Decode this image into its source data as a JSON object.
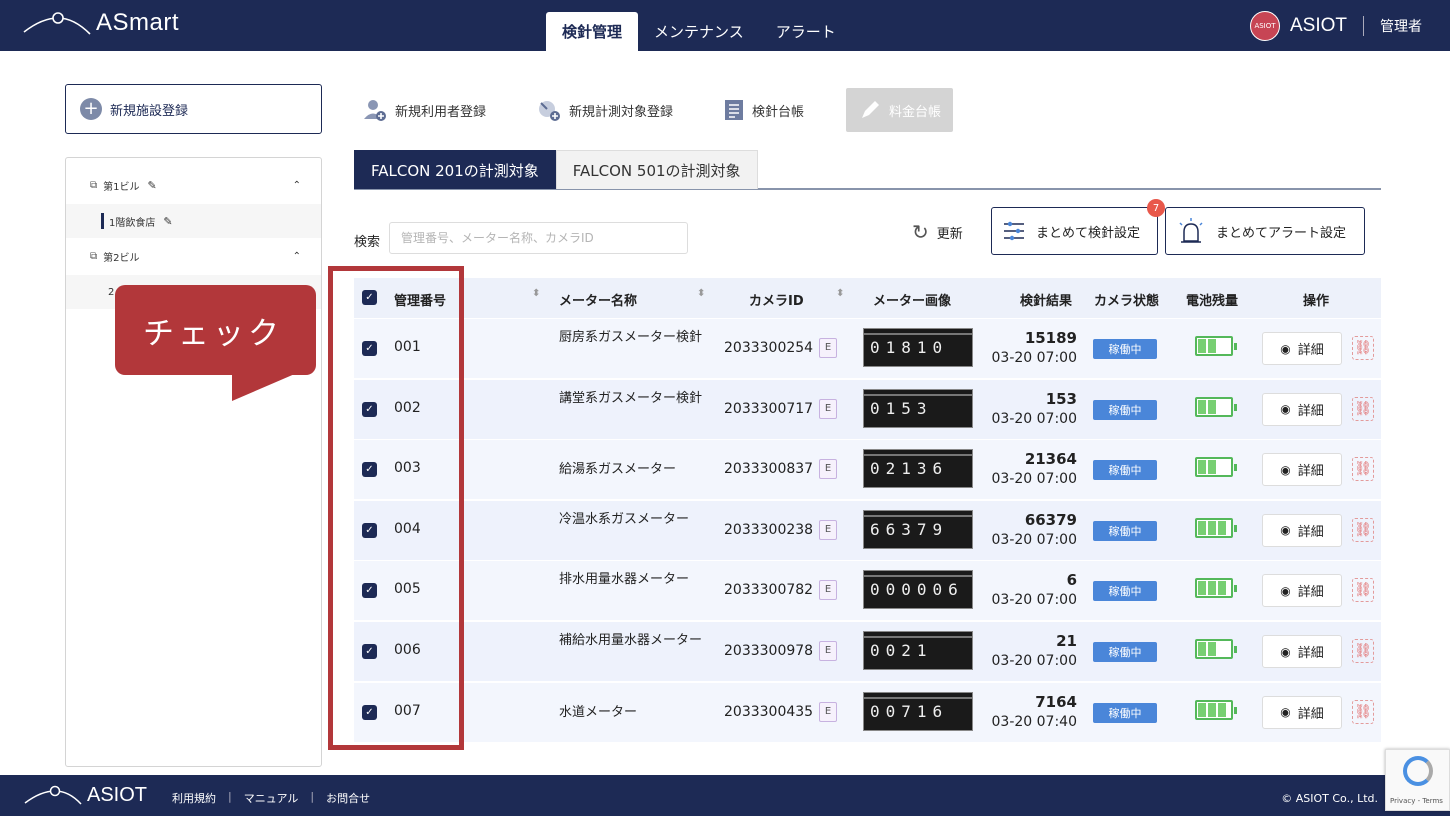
{
  "header": {
    "logo_text": "ASmart",
    "tabs": [
      "検針管理",
      "メンテナンス",
      "アラート"
    ],
    "badge_text": "ASIOT",
    "brand": "ASIOT",
    "role": "管理者"
  },
  "sidebar": {
    "new_facility": "新規施設登録",
    "tree": [
      {
        "label": "第1ビル"
      },
      {
        "label": "1階飲食店"
      },
      {
        "label": "第2ビル"
      },
      {
        "label": "2"
      }
    ]
  },
  "callout": "チェック",
  "toolbar": {
    "new_user": "新規利用者登録",
    "new_target": "新規計測対象登録",
    "ledger": "検針台帳",
    "fee_ledger": "料金台帳"
  },
  "falcon_tabs": [
    "FALCON 201の計測対象",
    "FALCON 501の計測対象"
  ],
  "search": {
    "label": "検索",
    "placeholder": "管理番号、メーター名称、カメラID"
  },
  "actions": {
    "refresh": "更新",
    "bulk_read": "まとめて検針設定",
    "bulk_alert": "まとめてアラート設定",
    "alert_count": "7"
  },
  "table": {
    "headers": [
      "管理番号",
      "メーター名称",
      "カメラID",
      "メーター画像",
      "検針結果",
      "カメラ状態",
      "電池残量",
      "操作"
    ],
    "rows": [
      {
        "id": "001",
        "name": "厨房系ガスメーター検針",
        "camera": "2033300254",
        "cam_type": "E",
        "img": "01810",
        "value": "15189",
        "date": "03-20 07:00",
        "status": "稼働中",
        "battery": 0.66,
        "detail": "詳細"
      },
      {
        "id": "002",
        "name": "講堂系ガスメーター検針",
        "camera": "2033300717",
        "cam_type": "E",
        "img": "0153",
        "value": "153",
        "date": "03-20 07:00",
        "status": "稼働中",
        "battery": 0.66,
        "detail": "詳細"
      },
      {
        "id": "003",
        "name": "給湯系ガスメーター",
        "camera": "2033300837",
        "cam_type": "E",
        "img": "02136",
        "value": "21364",
        "date": "03-20 07:00",
        "status": "稼働中",
        "battery": 0.66,
        "detail": "詳細"
      },
      {
        "id": "004",
        "name": "冷温水系ガスメーター",
        "camera": "2033300238",
        "cam_type": "E",
        "img": "66379",
        "value": "66379",
        "date": "03-20 07:00",
        "status": "稼働中",
        "battery": 1.0,
        "detail": "詳細"
      },
      {
        "id": "005",
        "name": "排水用量水器メーター",
        "camera": "2033300782",
        "cam_type": "E",
        "img": "000006",
        "value": "6",
        "date": "03-20 07:00",
        "status": "稼働中",
        "battery": 1.0,
        "detail": "詳細"
      },
      {
        "id": "006",
        "name": "補給水用量水器メーター",
        "camera": "2033300978",
        "cam_type": "E",
        "img": "0021",
        "value": "21",
        "date": "03-20 07:00",
        "status": "稼働中",
        "battery": 0.66,
        "detail": "詳細"
      },
      {
        "id": "007",
        "name": "水道メーター",
        "camera": "2033300435",
        "cam_type": "E",
        "img": "00716",
        "value": "7164",
        "date": "03-20 07:40",
        "status": "稼働中",
        "battery": 1.0,
        "detail": "詳細"
      }
    ]
  },
  "footer": {
    "logo_text": "ASIOT",
    "links": [
      "利用規約",
      "マニュアル",
      "お問合せ"
    ],
    "copyright": "© ASIOT Co., Ltd."
  },
  "recaptcha": "Privacy - Terms",
  "colors": {
    "navy": "#1d2a55",
    "status_blue": "#4a86d9",
    "battery_green": "#54b85a",
    "callout_red": "#b2373a"
  }
}
